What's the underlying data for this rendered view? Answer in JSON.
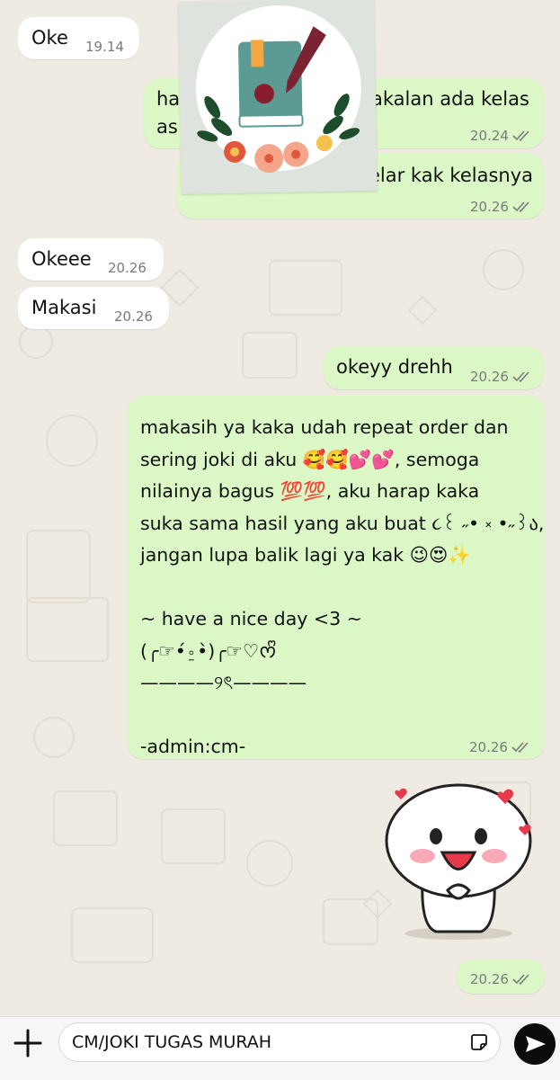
{
  "messages": [
    {
      "direction": "incoming",
      "text": "Oke",
      "time": "19.14"
    },
    {
      "direction": "outgoing",
      "text_left": "ha",
      "text_right": "akalan ada kelas",
      "text_line2": "as",
      "time": "20.24",
      "status": "read"
    },
    {
      "direction": "outgoing",
      "text": "elar kak kelasnya",
      "time": "20.26",
      "status": "read"
    },
    {
      "direction": "incoming",
      "text": "Okeee",
      "time": "20.26"
    },
    {
      "direction": "incoming",
      "text": "Makasi",
      "time": "20.26"
    },
    {
      "direction": "outgoing",
      "text": "okeyy drehh",
      "time": "20.26",
      "status": "read"
    },
    {
      "direction": "outgoing",
      "lines": [
        "makasih ya kaka udah repeat order dan",
        "sering joki di aku 🥰🥰💕💕, semoga",
        "nilainya bagus 💯💯, aku harap kaka",
        "suka sama hasil yang aku buat ૮꒰ ˶• ༝ •˶꒱ა,",
        "jangan lupa balik lagi ya kak 😉😍✨",
        "",
        "~ have a nice day <3 ~",
        "(╭☞•́⍛•̀)╭☞♡ᰔᩚ",
        "————୨ৎ————",
        "",
        "-admin:cm-"
      ],
      "time": "20.26",
      "status": "read"
    },
    {
      "direction": "outgoing",
      "type": "sticker",
      "time": "20.26",
      "status": "read"
    }
  ],
  "input": {
    "value": "CM/JOKI TUGAS MURAH"
  },
  "colors": {
    "outgoing_bubble": "#dbf8c6",
    "incoming_bubble": "#ffffff",
    "chat_background": "#efeae2",
    "send_button": "#0b0b0b"
  },
  "icons": {
    "attach": "plus-icon",
    "sticker": "sticker-icon",
    "send": "send-icon",
    "read": "double-check-icon"
  }
}
